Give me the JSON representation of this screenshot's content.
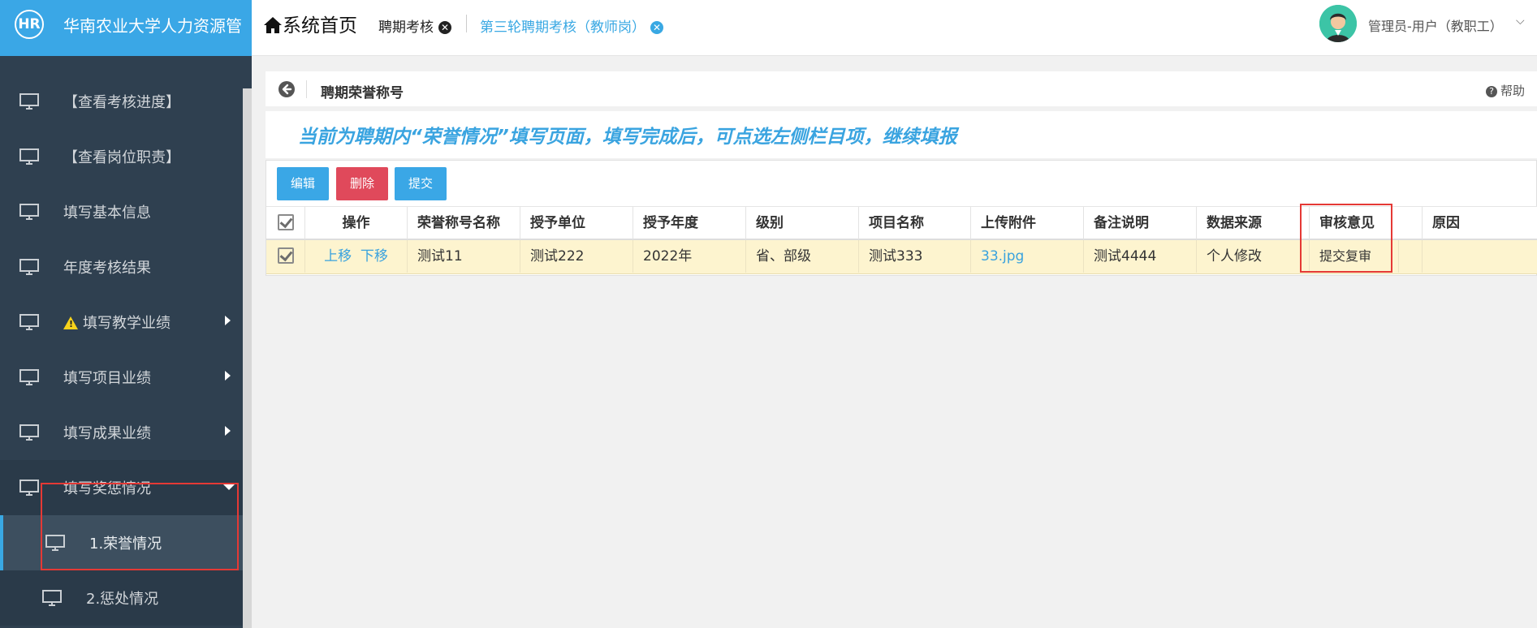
{
  "app": {
    "logo": "HR",
    "title": "华南农业大学人力资源管"
  },
  "header": {
    "home_label": "系统首页",
    "tabs": [
      {
        "label": "聘期考核"
      },
      {
        "label": "第三轮聘期考核（教师岗）"
      }
    ],
    "user": "管理员-用户（教职工）"
  },
  "sidebar": {
    "items": [
      {
        "label": "【查看考核进度】"
      },
      {
        "label": "【查看岗位职责】"
      },
      {
        "label": "填写基本信息"
      },
      {
        "label": "年度考核结果"
      },
      {
        "label": "填写教学业绩"
      },
      {
        "label": "填写项目业绩"
      },
      {
        "label": "填写成果业绩"
      },
      {
        "label": "填写奖惩情况"
      }
    ],
    "children": [
      {
        "label": "1.荣誉情况"
      },
      {
        "label": "2.惩处情况"
      }
    ]
  },
  "content": {
    "title": "聘期荣誉称号",
    "help": "帮助",
    "banner": "当前为聘期内“荣誉情况”填写页面，填写完成后，可点选左侧栏目项，继续填报"
  },
  "toolbar": {
    "edit": "编辑",
    "delete": "删除",
    "submit": "提交"
  },
  "table": {
    "columns": [
      "操作",
      "荣誉称号名称",
      "授予单位",
      "授予年度",
      "级别",
      "项目名称",
      "上传附件",
      "备注说明",
      "数据来源",
      "审核意见",
      "原因"
    ],
    "row": {
      "move_up": "上移",
      "move_down": "下移",
      "name": "测试11",
      "unit": "测试222",
      "year": "2022年",
      "level": "省、部级",
      "project": "测试333",
      "attachment": "33.jpg",
      "remark": "测试4444",
      "source": "个人修改",
      "review": "提交复审",
      "reason": ""
    }
  },
  "colors": {
    "accent": "#3aa7e6",
    "sidebar_bg": "#2f4050",
    "danger": "#e0495b",
    "row_selected": "#fdf4cf",
    "annotation": "#e53935"
  }
}
